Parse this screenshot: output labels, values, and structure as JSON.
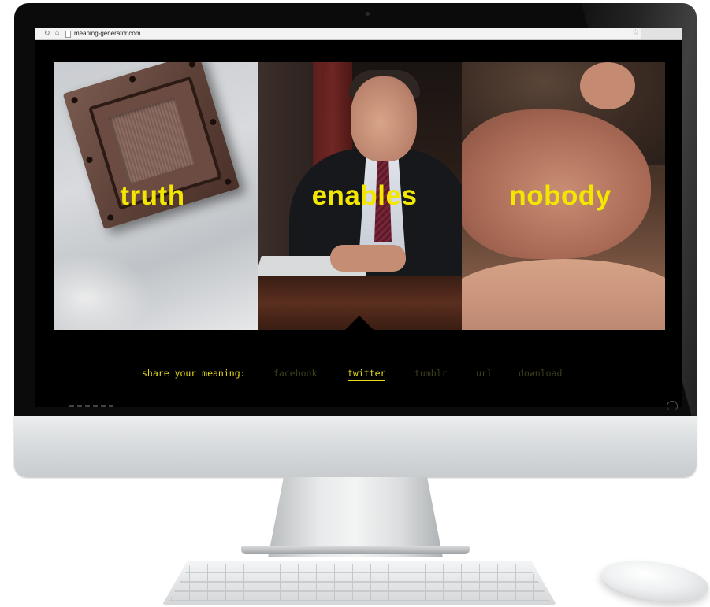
{
  "browser": {
    "url": "meaning-generator.com",
    "reload_icon": "reload-icon",
    "home_icon": "home-icon",
    "page_icon": "page-icon",
    "bookmark_icon": "star-icon"
  },
  "panels": [
    {
      "word": "truth"
    },
    {
      "word": "enables"
    },
    {
      "word": "nobody"
    }
  ],
  "share": {
    "label": "share your meaning:",
    "links": [
      {
        "label": "facebook",
        "active": false
      },
      {
        "label": "twitter",
        "active": true
      },
      {
        "label": "tumblr",
        "active": false
      },
      {
        "label": "url",
        "active": false
      },
      {
        "label": "download",
        "active": false
      }
    ]
  },
  "colors": {
    "accent_yellow": "#f3e600",
    "inactive_link": "#3e3e1e",
    "screen_bg": "#000000"
  }
}
